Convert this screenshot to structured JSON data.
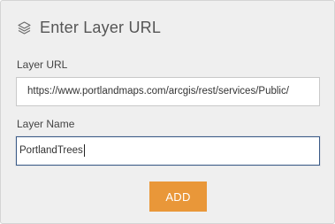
{
  "panel": {
    "title": "Enter Layer URL",
    "header_icon": "layers-icon"
  },
  "layer_url": {
    "label": "Layer URL",
    "value": "https://www.portlandmaps.com/arcgis/rest/services/Public/"
  },
  "layer_name": {
    "label": "Layer Name",
    "value": "PortlandTrees"
  },
  "actions": {
    "add_label": "ADD"
  },
  "colors": {
    "accent_button": "#e99739",
    "focus_border": "#3a5a86",
    "panel_background": "#efefef"
  }
}
